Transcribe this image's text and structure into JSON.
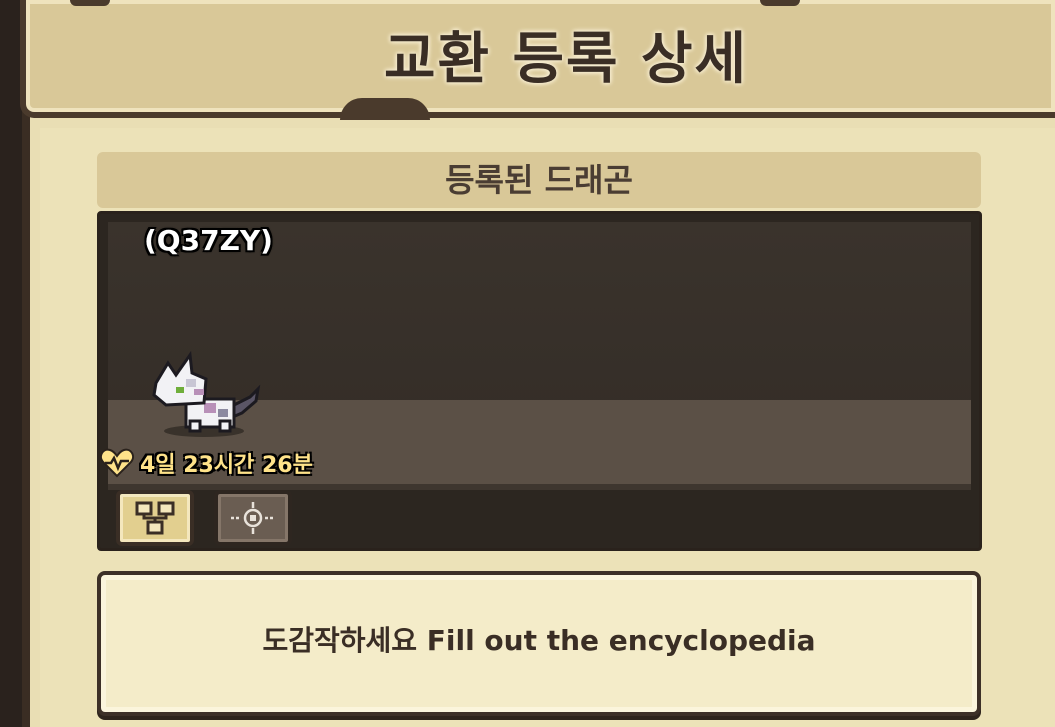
{
  "title": "교환 등록 상세",
  "section_title": "등록된 드래곤",
  "dragon": {
    "code": "(Q37ZY)",
    "timer": "4일 23시간 26분",
    "timer_icon": "heart-pulse-icon"
  },
  "buttons": {
    "family_tree": "family-tree-icon",
    "target": "target-icon"
  },
  "message": "도감작하세요 Fill out the encyclopedia",
  "colors": {
    "panel": "#ece2b8",
    "header": "#d9c898",
    "dark_frame": "#3a2d23",
    "timer_text": "#ffe38a"
  }
}
